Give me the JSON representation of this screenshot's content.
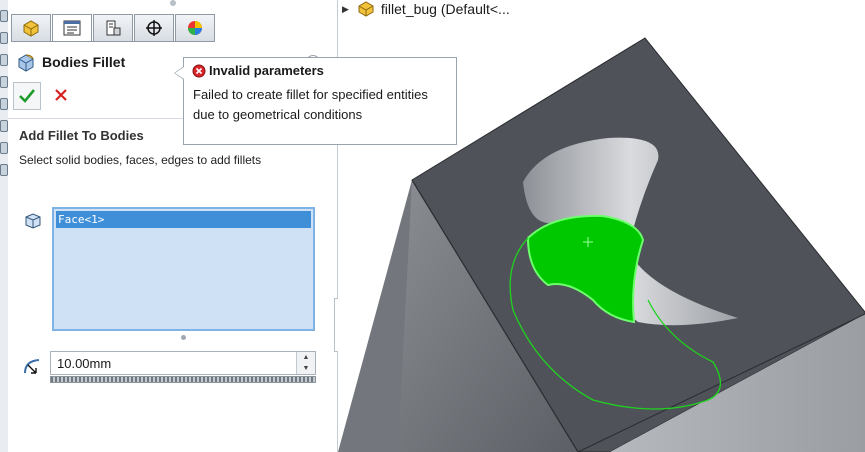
{
  "property_manager": {
    "title": "Bodies Fillet",
    "tabs": [
      "feature-manager-icon",
      "property-manager-icon",
      "configuration-manager-icon",
      "dimxpert-icon",
      "display-manager-icon"
    ],
    "section_title": "Add Fillet To Bodies",
    "section_description": "Select solid bodies, faces, edges to add fillets",
    "selection_items": [
      "Face<1>"
    ],
    "radius_value": "10.00mm"
  },
  "tooltip": {
    "title": "Invalid parameters",
    "message": "Failed to create fillet for specified entities due to geometrical conditions"
  },
  "feature_tree": {
    "label": "fillet_bug  (Default<..."
  },
  "colors": {
    "selection_green": "#00c800",
    "model_gray": "#50535a",
    "list_highlight": "#3f8fd8",
    "list_background": "#cfe2f5"
  }
}
